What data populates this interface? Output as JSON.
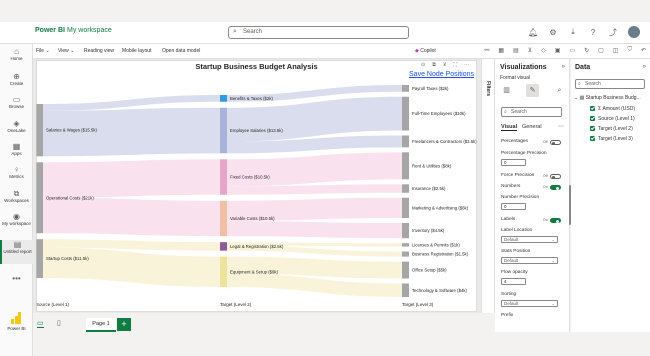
{
  "topbar": {
    "brand": "Power BI",
    "workspace": "My workspace",
    "search_placeholder": "Search",
    "icons": [
      "bell-icon",
      "gear-icon",
      "download-icon",
      "help-icon",
      "share-icon",
      "avatar"
    ]
  },
  "leftnav": {
    "items": [
      {
        "icon": "⌂",
        "label": "Home"
      },
      {
        "icon": "⊕",
        "label": "Create"
      },
      {
        "icon": "▭",
        "label": "Browse"
      },
      {
        "icon": "◈",
        "label": "OneLake"
      },
      {
        "icon": "▦",
        "label": "Apps"
      },
      {
        "icon": "♀",
        "label": "Metrics"
      },
      {
        "icon": "⧉",
        "label": "Workspaces"
      },
      {
        "icon": "◉",
        "label": "My workspace"
      },
      {
        "icon": "▤",
        "label": "Untitled report"
      },
      {
        "icon": "•••",
        "label": ""
      }
    ],
    "bottom_label": "Power BI"
  },
  "ribbon": {
    "items": [
      "File ⌄",
      "View ⌄",
      "Reading view",
      "Mobile layout",
      "Open data model"
    ],
    "copilot": "Copilot"
  },
  "visual": {
    "save_label": "Save Node Positions"
  },
  "filters": {
    "label": "Filters"
  },
  "viz_pane": {
    "title": "Visualizations",
    "subtitle": "Format visual",
    "search_placeholder": "Search",
    "tabs": [
      "Visual",
      "General"
    ],
    "rows": [
      {
        "label": "Percentages",
        "control": "toggle",
        "value": "Off"
      },
      {
        "label": "Percentage Precision",
        "control": "number",
        "value": "0"
      },
      {
        "label": "Force Precision",
        "control": "toggle",
        "value": "Off"
      },
      {
        "label": "Numbers",
        "control": "toggle",
        "value": "On"
      },
      {
        "label": "Number Precision",
        "control": "number",
        "value": "0"
      },
      {
        "label": "Labels",
        "control": "toggle",
        "value": "On"
      },
      {
        "label": "Label Location",
        "control": "select",
        "value": "Default"
      },
      {
        "label": "Stats Position",
        "control": "select",
        "value": "Default"
      },
      {
        "label": "Flow opacity",
        "control": "number",
        "value": "4"
      },
      {
        "label": "Sorting",
        "control": "select",
        "value": "Default"
      },
      {
        "label": "Prefix",
        "control": "none",
        "value": ""
      }
    ]
  },
  "data_pane": {
    "title": "Data",
    "search_placeholder": "Search",
    "table": "Startup Business Budg...",
    "fields": [
      "Amount (USD)",
      "Source (Level 1)",
      "Target (Level 2)",
      "Target (Level 3)"
    ]
  },
  "bottombar": {
    "page_label": "Page 1",
    "add_label": "+"
  },
  "colors": {
    "brand": "#107c41",
    "link": "#1b4ef5",
    "salaries": "#c9cfe6",
    "operational": "#f6d5e6",
    "startup": "#f6eec9",
    "node": "#a6a6a6"
  },
  "chart_data": {
    "type": "sankey",
    "title": "Startup Business Budget Analysis",
    "column_labels": [
      "Source (Level 1)",
      "Target (Level 2)",
      "Target (Level 3)"
    ],
    "unit": "$k",
    "level1": [
      {
        "name": "Salaries & Wages",
        "value": 15.5,
        "label": "Salaries & Wages ($15.5k)"
      },
      {
        "name": "Operational Costs",
        "value": 21,
        "label": "Operational Costs ($21k)"
      },
      {
        "name": "Startup Costs",
        "value": 11.5,
        "label": "Startup Costs ($11.5k)"
      }
    ],
    "level2": [
      {
        "name": "Benefits & Taxes",
        "value": 2,
        "parent": "Salaries & Wages",
        "label": "Benefits & Taxes ($2k)",
        "color": "#2e9be6"
      },
      {
        "name": "Employee Salaries",
        "value": 13.5,
        "parent": "Salaries & Wages",
        "label": "Employee Salaries ($13.5k)",
        "color": "#a9b3d9"
      },
      {
        "name": "Fixed Costs",
        "value": 10.5,
        "parent": "Operational Costs",
        "label": "Fixed Costs ($10.5k)",
        "color": "#e5a6c8"
      },
      {
        "name": "Variable Costs",
        "value": 10.5,
        "parent": "Operational Costs",
        "label": "Variable Costs ($10.5k)",
        "color": "#efbfa6"
      },
      {
        "name": "Legal & Registration",
        "value": 2.5,
        "parent": "Startup Costs",
        "label": "Legal & Registration ($2.5k)",
        "color": "#8e5a9e"
      },
      {
        "name": "Equipment & Setup",
        "value": 9,
        "parent": "Startup Costs",
        "label": "Equipment & Setup ($9k)",
        "color": "#eee39a"
      }
    ],
    "level3": [
      {
        "name": "Payroll Taxes",
        "value": 2,
        "parent": "Benefits & Taxes",
        "label": "Payroll Taxes ($2k)"
      },
      {
        "name": "Full-Time Employees",
        "value": 10,
        "parent": "Employee Salaries",
        "label": "Full-Time Employees ($10k)"
      },
      {
        "name": "Freelancers & Contractors",
        "value": 3.5,
        "parent": "Employee Salaries",
        "label": "Freelancers & Contractors ($3.5k)"
      },
      {
        "name": "Rent & Utilities",
        "value": 8,
        "parent": "Fixed Costs",
        "label": "Rent & Utilities ($8k)"
      },
      {
        "name": "Insurance",
        "value": 2.5,
        "parent": "Fixed Costs",
        "label": "Insurance ($2.5k)"
      },
      {
        "name": "Marketing & Advertising",
        "value": 6,
        "parent": "Variable Costs",
        "label": "Marketing & Advertising ($6k)"
      },
      {
        "name": "Inventory",
        "value": 4.5,
        "parent": "Variable Costs",
        "label": "Inventory ($4.5k)"
      },
      {
        "name": "Licenses & Permits",
        "value": 1,
        "parent": "Legal & Registration",
        "label": "Licenses & Permits ($1k)"
      },
      {
        "name": "Business Registration",
        "value": 1.5,
        "parent": "Legal & Registration",
        "label": "Business Registration ($1.5k)"
      },
      {
        "name": "Office Setup",
        "value": 5,
        "parent": "Equipment & Setup",
        "label": "Office Setup ($5k)"
      },
      {
        "name": "Technology & Software",
        "value": 4,
        "parent": "Equipment & Setup",
        "label": "Technology & Software ($4k)"
      }
    ]
  }
}
